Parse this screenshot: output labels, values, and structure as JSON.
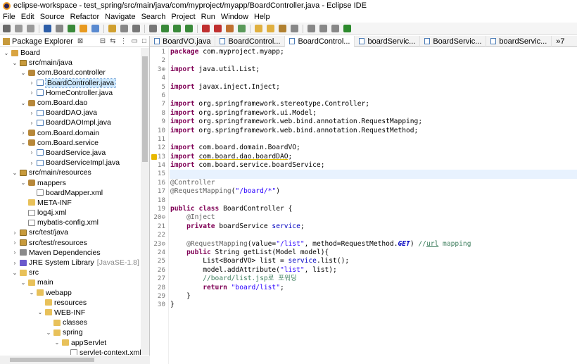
{
  "window": {
    "title": "eclipse-workspace - test_spring/src/main/java/com/myproject/myapp/BoardController.java - Eclipse IDE"
  },
  "menu": [
    "File",
    "Edit",
    "Source",
    "Refactor",
    "Navigate",
    "Search",
    "Project",
    "Run",
    "Window",
    "Help"
  ],
  "package_explorer": {
    "tab_label": "Package Explorer",
    "close_glyph": "⊠",
    "tree": [
      {
        "label": "Board",
        "extra": "",
        "depth": 0,
        "arrow": "v",
        "icon": "proj"
      },
      {
        "label": "src/main/java",
        "extra": "",
        "depth": 1,
        "arrow": "v",
        "icon": "src"
      },
      {
        "label": "com.Board.controller",
        "extra": "",
        "depth": 2,
        "arrow": "v",
        "icon": "pkg"
      },
      {
        "label": "BoardController.java",
        "extra": "",
        "depth": 3,
        "arrow": ">",
        "icon": "java",
        "selected": true
      },
      {
        "label": "HomeController.java",
        "extra": "",
        "depth": 3,
        "arrow": ">",
        "icon": "java"
      },
      {
        "label": "com.Board.dao",
        "extra": "",
        "depth": 2,
        "arrow": "v",
        "icon": "pkg"
      },
      {
        "label": "BoardDAO.java",
        "extra": "",
        "depth": 3,
        "arrow": ">",
        "icon": "java"
      },
      {
        "label": "BoardDAOImpl.java",
        "extra": "",
        "depth": 3,
        "arrow": ">",
        "icon": "java"
      },
      {
        "label": "com.Board.domain",
        "extra": "",
        "depth": 2,
        "arrow": ">",
        "icon": "pkg"
      },
      {
        "label": "com.Board.service",
        "extra": "",
        "depth": 2,
        "arrow": "v",
        "icon": "pkg"
      },
      {
        "label": "BoardService.java",
        "extra": "",
        "depth": 3,
        "arrow": ">",
        "icon": "java"
      },
      {
        "label": "BoardServiceImpl.java",
        "extra": "",
        "depth": 3,
        "arrow": ">",
        "icon": "java"
      },
      {
        "label": "src/main/resources",
        "extra": "",
        "depth": 1,
        "arrow": "v",
        "icon": "src"
      },
      {
        "label": "mappers",
        "extra": "",
        "depth": 2,
        "arrow": "v",
        "icon": "pkg"
      },
      {
        "label": "boardMapper.xml",
        "extra": "",
        "depth": 3,
        "arrow": "",
        "icon": "xml"
      },
      {
        "label": "META-INF",
        "extra": "",
        "depth": 2,
        "arrow": "",
        "icon": "folder"
      },
      {
        "label": "log4j.xml",
        "extra": "",
        "depth": 2,
        "arrow": "",
        "icon": "xml"
      },
      {
        "label": "mybatis-config.xml",
        "extra": "",
        "depth": 2,
        "arrow": "",
        "icon": "xml"
      },
      {
        "label": "src/test/java",
        "extra": "",
        "depth": 1,
        "arrow": ">",
        "icon": "src"
      },
      {
        "label": "src/test/resources",
        "extra": "",
        "depth": 1,
        "arrow": ">",
        "icon": "src"
      },
      {
        "label": "Maven Dependencies",
        "extra": "",
        "depth": 1,
        "arrow": ">",
        "icon": "lib"
      },
      {
        "label": "JRE System Library",
        "extra": "[JavaSE-1.8]",
        "depth": 1,
        "arrow": ">",
        "icon": "jre"
      },
      {
        "label": "src",
        "extra": "",
        "depth": 1,
        "arrow": "v",
        "icon": "folder"
      },
      {
        "label": "main",
        "extra": "",
        "depth": 2,
        "arrow": "v",
        "icon": "folder"
      },
      {
        "label": "webapp",
        "extra": "",
        "depth": 3,
        "arrow": "v",
        "icon": "folder"
      },
      {
        "label": "resources",
        "extra": "",
        "depth": 4,
        "arrow": "",
        "icon": "folder"
      },
      {
        "label": "WEB-INF",
        "extra": "",
        "depth": 4,
        "arrow": "v",
        "icon": "folder"
      },
      {
        "label": "classes",
        "extra": "",
        "depth": 5,
        "arrow": "",
        "icon": "folder"
      },
      {
        "label": "spring",
        "extra": "",
        "depth": 5,
        "arrow": "v",
        "icon": "folder"
      },
      {
        "label": "appServlet",
        "extra": "",
        "depth": 6,
        "arrow": "v",
        "icon": "folder"
      },
      {
        "label": "servlet-context.xml",
        "extra": "",
        "depth": 7,
        "arrow": "",
        "icon": "xml"
      }
    ]
  },
  "editor_tabs": [
    {
      "label": "BoardVO.java",
      "active": false
    },
    {
      "label": "BoardControl...",
      "active": false
    },
    {
      "label": "BoardControl...",
      "active": true
    },
    {
      "label": "boardServic...",
      "active": false
    },
    {
      "label": "BoardServic...",
      "active": false
    },
    {
      "label": "boardServic...",
      "active": false
    }
  ],
  "editor_overflow": "»7",
  "code_lines": [
    {
      "n": "1",
      "fold": "",
      "html": "<span class='kw'>package</span> com.myproject.myapp;"
    },
    {
      "n": "2",
      "fold": "",
      "html": ""
    },
    {
      "n": "3",
      "fold": "⊕",
      "html": "<span class='kw'>import</span> java.util.List;"
    },
    {
      "n": "4",
      "fold": "",
      "html": ""
    },
    {
      "n": "5",
      "fold": "",
      "html": "<span class='kw'>import</span> javax.inject.Inject;"
    },
    {
      "n": "6",
      "fold": "",
      "html": ""
    },
    {
      "n": "7",
      "fold": "",
      "html": "<span class='kw'>import</span> org.springframework.stereotype.Controller;"
    },
    {
      "n": "8",
      "fold": "",
      "html": "<span class='kw'>import</span> org.springframework.ui.Model;"
    },
    {
      "n": "9",
      "fold": "",
      "html": "<span class='kw'>import</span> org.springframework.web.bind.annotation.RequestMapping;"
    },
    {
      "n": "10",
      "fold": "",
      "html": "<span class='kw'>import</span> org.springframework.web.bind.annotation.RequestMethod;"
    },
    {
      "n": "11",
      "fold": "",
      "html": ""
    },
    {
      "n": "12",
      "fold": "",
      "html": "<span class='kw'>import</span> com.board.domain.BoardVO;"
    },
    {
      "n": "13",
      "fold": "",
      "warn": true,
      "html": "<span class='kw'>import</span> <span class='ul'>com.board.dao.boardDAO</span>;"
    },
    {
      "n": "14",
      "fold": "",
      "html": "<span class='kw'>import</span> com.board.service.boardService;"
    },
    {
      "n": "15",
      "fold": "",
      "cur": true,
      "html": ""
    },
    {
      "n": "16",
      "fold": "",
      "html": "<span class='ann'>@Controller</span>"
    },
    {
      "n": "17",
      "fold": "",
      "html": "<span class='ann'>@RequestMapping</span>(<span class='str'>\"/board/*\"</span>)"
    },
    {
      "n": "18",
      "fold": "",
      "html": ""
    },
    {
      "n": "19",
      "fold": "",
      "html": "<span class='kw'>public</span> <span class='kw'>class</span> BoardController {"
    },
    {
      "n": "20",
      "fold": "⊖",
      "html": "    <span class='ann'>@Inject</span>"
    },
    {
      "n": "21",
      "fold": "",
      "html": "    <span class='kw'>private</span> boardService <span class='fld'>service</span>;"
    },
    {
      "n": "22",
      "fold": "",
      "html": ""
    },
    {
      "n": "23",
      "fold": "⊖",
      "html": "    <span class='ann'>@RequestMapping</span>(value=<span class='str'>\"/list\"</span>, method=RequestMethod.<span class='fld' style='font-style:italic;font-weight:bold'>GET</span>) <span class='cm'>//<u>url</u> mapping</span>"
    },
    {
      "n": "24",
      "fold": "",
      "html": "    <span class='kw'>public</span> String getList(Model model){"
    },
    {
      "n": "25",
      "fold": "",
      "html": "        List&lt;BoardVO&gt; list = <span class='fld'>service</span>.list();"
    },
    {
      "n": "26",
      "fold": "",
      "html": "        model.addAttribute(<span class='str'>\"list\"</span>, list);"
    },
    {
      "n": "27",
      "fold": "",
      "html": "        <span class='cm'>//board/list.jsp로 포워딩</span>"
    },
    {
      "n": "28",
      "fold": "",
      "html": "        <span class='kw'>return</span> <span class='str'>\"board/list\"</span>;"
    },
    {
      "n": "29",
      "fold": "",
      "html": "    }"
    },
    {
      "n": "30",
      "fold": "",
      "html": "}"
    }
  ]
}
